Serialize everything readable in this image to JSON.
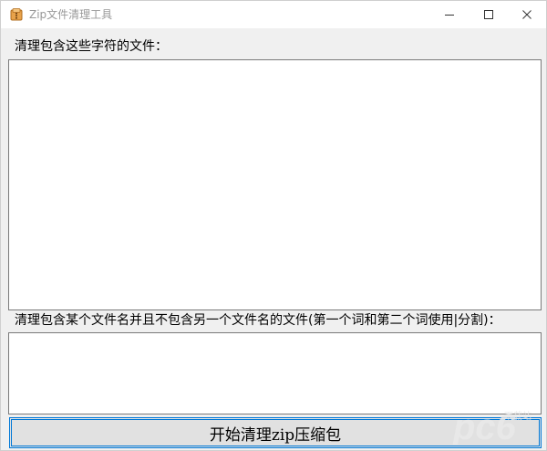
{
  "window": {
    "title": "Zip文件清理工具",
    "app_icon": "archive-icon"
  },
  "controls": {
    "minimize": "minimize-icon",
    "maximize": "maximize-icon",
    "close": "close-icon"
  },
  "form": {
    "include_label": "清理包含这些字符的文件：",
    "include_value": "",
    "exclude_label": "清理包含某个文件名并且不包含另一个文件名的文件(第一个词和第二个词使用|分割)：",
    "exclude_value": "",
    "start_button": "开始清理zip压缩包"
  },
  "watermark": {
    "text": "pc6",
    "subtext": "下载站"
  },
  "colors": {
    "accent": "#0078d7",
    "watermark": "#e9e9e9"
  }
}
